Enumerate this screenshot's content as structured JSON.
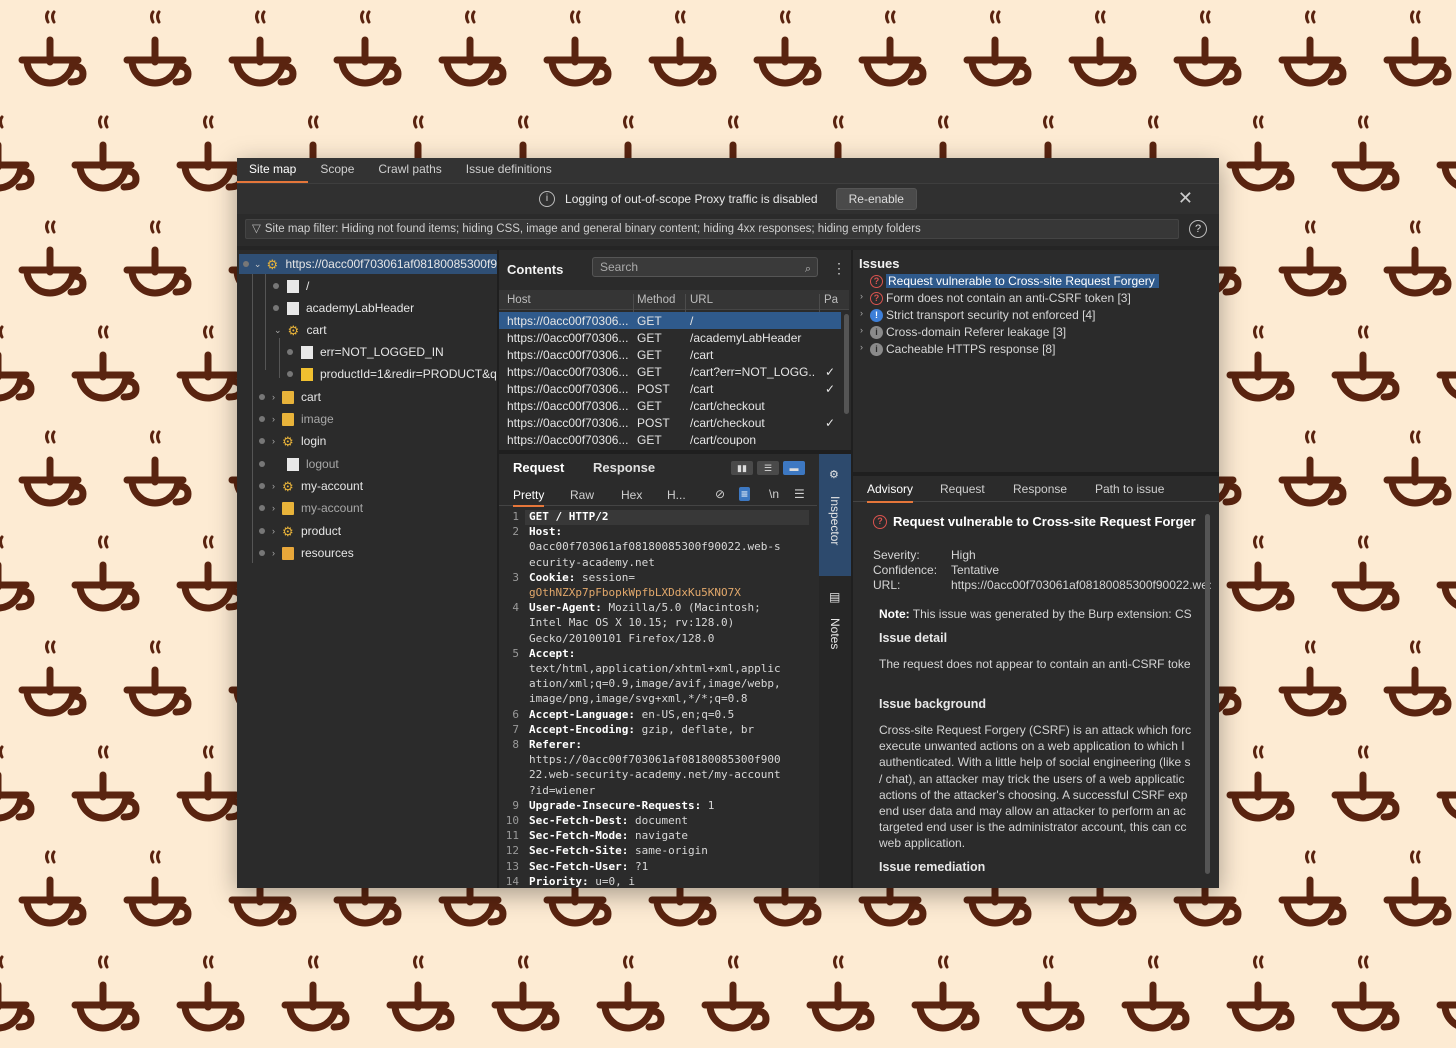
{
  "tabs": [
    "Site map",
    "Scope",
    "Crawl paths",
    "Issue definitions"
  ],
  "banner": {
    "message": "Logging of out-of-scope Proxy traffic is disabled",
    "button": "Re-enable"
  },
  "filter": "Site map filter: Hiding not found items; hiding CSS, image and general binary content; hiding 4xx responses; hiding empty folders",
  "tree": {
    "root": "https://0acc00f703061af08180085300f9",
    "items": [
      "/",
      "academyLabHeader",
      "cart",
      "err=NOT_LOGGED_IN",
      "productId=1&redir=PRODUCT&qu",
      "cart",
      "image",
      "login",
      "logout",
      "my-account",
      "my-account",
      "product",
      "resources"
    ]
  },
  "contents": {
    "title": "Contents",
    "search_placeholder": "Search",
    "columns": [
      "Host",
      "Method",
      "URL",
      "Pa"
    ],
    "rows": [
      {
        "host": "https://0acc00f70306...",
        "method": "GET",
        "url": "/",
        "params": ""
      },
      {
        "host": "https://0acc00f70306...",
        "method": "GET",
        "url": "/academyLabHeader",
        "params": ""
      },
      {
        "host": "https://0acc00f70306...",
        "method": "GET",
        "url": "/cart",
        "params": ""
      },
      {
        "host": "https://0acc00f70306...",
        "method": "GET",
        "url": "/cart?err=NOT_LOGG...",
        "params": "✓"
      },
      {
        "host": "https://0acc00f70306...",
        "method": "POST",
        "url": "/cart",
        "params": "✓"
      },
      {
        "host": "https://0acc00f70306...",
        "method": "GET",
        "url": "/cart/checkout",
        "params": ""
      },
      {
        "host": "https://0acc00f70306...",
        "method": "POST",
        "url": "/cart/checkout",
        "params": "✓"
      },
      {
        "host": "https://0acc00f70306...",
        "method": "GET",
        "url": "/cart/coupon",
        "params": ""
      }
    ]
  },
  "request": {
    "tabs": [
      "Request",
      "Response"
    ],
    "subtabs": [
      "Pretty",
      "Raw",
      "Hex",
      "H..."
    ],
    "subicons": [
      "\\n"
    ],
    "lines": [
      {
        "n": "1",
        "k": "GET / HTTP/2",
        "v": ""
      },
      {
        "n": "2",
        "k": "Host:",
        "v": ""
      },
      {
        "n": "",
        "k": "",
        "v": "0acc00f703061af08180085300f90022.web-s"
      },
      {
        "n": "",
        "k": "",
        "v": "ecurity-academy.net"
      },
      {
        "n": "3",
        "k": "Cookie:",
        "v": " session="
      },
      {
        "n": "",
        "k": "",
        "v": "gOthNZXp7pFbopkWpfbLXDdxKu5KNO7X"
      },
      {
        "n": "4",
        "k": "User-Agent:",
        "v": " Mozilla/5.0 (Macintosh;"
      },
      {
        "n": "",
        "k": "",
        "v": "Intel Mac OS X 10.15; rv:128.0)"
      },
      {
        "n": "",
        "k": "",
        "v": "Gecko/20100101 Firefox/128.0"
      },
      {
        "n": "5",
        "k": "Accept:",
        "v": ""
      },
      {
        "n": "",
        "k": "",
        "v": "text/html,application/xhtml+xml,applic"
      },
      {
        "n": "",
        "k": "",
        "v": "ation/xml;q=0.9,image/avif,image/webp,"
      },
      {
        "n": "",
        "k": "",
        "v": "image/png,image/svg+xml,*/*;q=0.8"
      },
      {
        "n": "6",
        "k": "Accept-Language:",
        "v": " en-US,en;q=0.5"
      },
      {
        "n": "7",
        "k": "Accept-Encoding:",
        "v": " gzip, deflate, br"
      },
      {
        "n": "8",
        "k": "Referer:",
        "v": ""
      },
      {
        "n": "",
        "k": "",
        "v": "https://0acc00f703061af08180085300f900"
      },
      {
        "n": "",
        "k": "",
        "v": "22.web-security-academy.net/my-account"
      },
      {
        "n": "",
        "k": "",
        "v": "?id=wiener"
      },
      {
        "n": "9",
        "k": "Upgrade-Insecure-Requests:",
        "v": " 1"
      },
      {
        "n": "10",
        "k": "Sec-Fetch-Dest:",
        "v": " document"
      },
      {
        "n": "11",
        "k": "Sec-Fetch-Mode:",
        "v": " navigate"
      },
      {
        "n": "12",
        "k": "Sec-Fetch-Site:",
        "v": " same-origin"
      },
      {
        "n": "13",
        "k": "Sec-Fetch-User:",
        "v": " ?1"
      },
      {
        "n": "14",
        "k": "Priority:",
        "v": " u=0, i"
      }
    ]
  },
  "sidebar": {
    "inspector": "Inspector",
    "notes": "Notes"
  },
  "issues": {
    "title": "Issues",
    "items": [
      {
        "label": "Request vulnerable to Cross-site Request Forgery",
        "severity": "red"
      },
      {
        "label": "Form does not contain an anti-CSRF token [3]",
        "severity": "red"
      },
      {
        "label": "Strict transport security not enforced [4]",
        "severity": "blue"
      },
      {
        "label": "Cross-domain Referer leakage [3]",
        "severity": "grey"
      },
      {
        "label": "Cacheable HTTPS response [8]",
        "severity": "grey"
      }
    ]
  },
  "advisory": {
    "tabs": [
      "Advisory",
      "Request",
      "Response",
      "Path to issue"
    ],
    "title": "Request vulnerable to Cross-site Request Forger",
    "severity_label": "Severity:",
    "severity": "High",
    "confidence_label": "Confidence:",
    "confidence": "Tentative",
    "url_label": "URL:",
    "url": "https://0acc00f703061af08180085300f90022.web",
    "note_label": "Note:",
    "note": " This issue was generated by the Burp extension: CS",
    "detail_heading": "Issue detail",
    "detail": "The request does not appear to contain an anti-CSRF toke",
    "background_heading": "Issue background",
    "background_lines": [
      "Cross-site Request Forgery (CSRF) is an attack which forc",
      "execute unwanted actions on a web application to which I",
      "authenticated. With a little help of social engineering (like s",
      "/ chat), an attacker may trick the users of a web applicatic",
      "actions of the attacker's choosing. A successful CSRF exp",
      "end user data and may allow an attacker to perform an ac",
      "targeted end user is the administrator account, this can cc",
      "web application."
    ],
    "remediation_heading": "Issue remediation"
  },
  "colors": {
    "accent": "#e5763a",
    "selection": "#2f5a8c",
    "background": "#fdebd3",
    "pattern": "#5a2410"
  }
}
